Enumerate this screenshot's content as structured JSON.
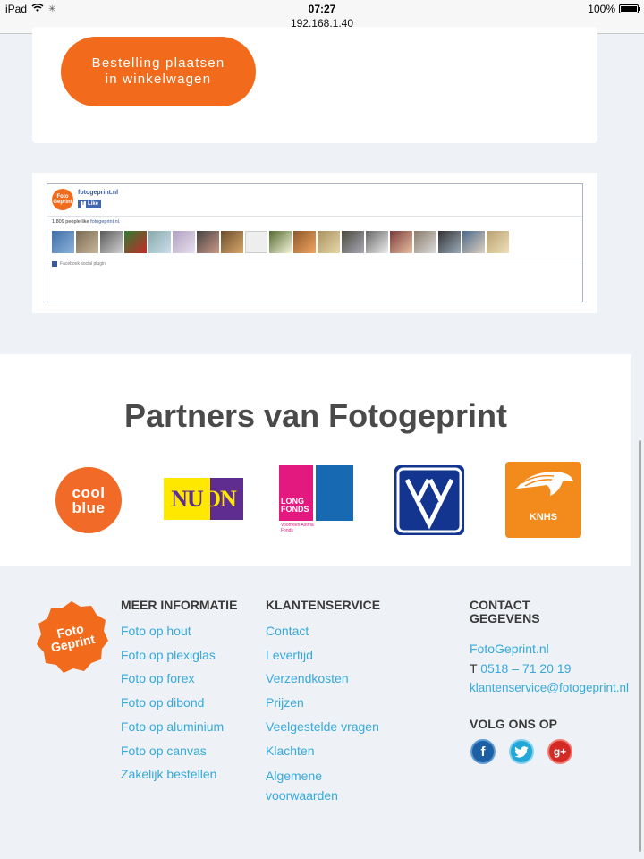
{
  "status_bar": {
    "device": "iPad",
    "time": "07:27",
    "url": "192.168.1.40",
    "battery": "100%",
    "battery_level": 1.0
  },
  "order_button": {
    "label": "Bestelling plaatsen in winkelwagen"
  },
  "facebook_widget": {
    "page_name": "fotogeprint.nl",
    "like_label": "Like",
    "likes_count": "1,809 people like",
    "likes_page": "fotogeprint.nl.",
    "plugin_label": "Facebook social plugin",
    "logo_text": "Foto Geprint"
  },
  "partners": {
    "title": "Partners van Fotogeprint",
    "logos": [
      {
        "name": "coolblue",
        "text": "cool blue"
      },
      {
        "name": "nuon",
        "text": "NUON"
      },
      {
        "name": "longfonds",
        "text": "LONG FONDS",
        "subtext": "Voorheen Astma Fonds"
      },
      {
        "name": "vvv",
        "text": "VVV"
      },
      {
        "name": "knhs",
        "text": "KNHS"
      }
    ]
  },
  "footer": {
    "logo_text": "Foto Geprint",
    "meer_informatie": {
      "heading": "MEER INFORMATIE",
      "links": [
        "Foto op hout",
        "Foto op plexiglas",
        "Foto op forex",
        "Foto op dibond",
        "Foto op aluminium",
        "Foto op canvas",
        "Zakelijk bestellen"
      ]
    },
    "klantenservice": {
      "heading": "KLANTENSERVICE",
      "links": [
        "Contact",
        "Levertijd",
        "Verzendkosten",
        "Prijzen",
        "Veelgestelde vragen",
        "Klachten",
        "Algemene voorwaarden"
      ]
    },
    "contact": {
      "heading_line1": "CONTACT",
      "heading_line2": "GEGEVENS",
      "site": "FotoGeprint.nl",
      "phone_prefix": "T",
      "phone": "0518 – 71 20 19",
      "email": "klantenservice@fotogeprint.nl"
    },
    "social": {
      "heading": "VOLG ONS OP",
      "facebook": "f",
      "twitter": "twitter-icon",
      "googleplus": "g+"
    }
  },
  "colors": {
    "accent_orange": "#f26a1b",
    "link_blue": "#36a9dd",
    "page_bg": "#eef1f5"
  }
}
